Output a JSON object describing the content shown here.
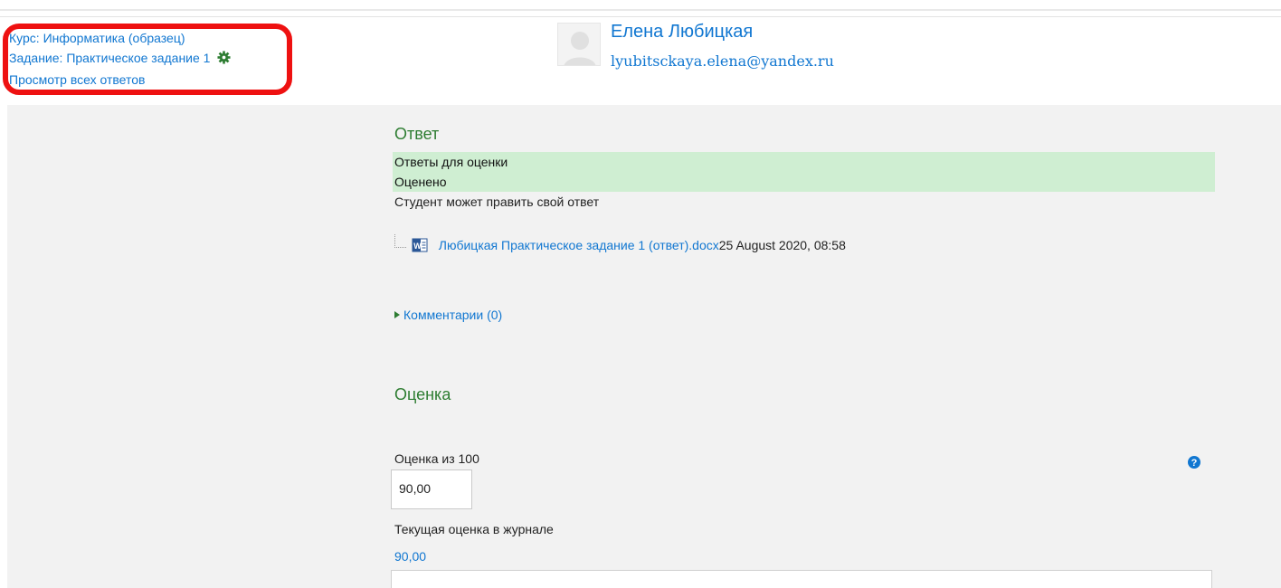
{
  "breadcrumbs": {
    "course": "Курс: Информатика (образец)",
    "assignment": "Задание: Практическое задание 1",
    "view_all": "Просмотр всех ответов"
  },
  "user": {
    "name": "Елена Любицкая",
    "email": "lyubitsckaya.elena@yandex.ru"
  },
  "submission": {
    "heading": "Ответ",
    "status_submission": "Ответы для оценки",
    "status_grading": "Оценено",
    "edit_status": "Студент может править свой ответ",
    "file": {
      "name": "Любицкая Практическое задание 1 (ответ).docx",
      "date": "25 August 2020, 08:58",
      "icon": "word-doc-icon"
    },
    "comments_label": "Комментарии (0)"
  },
  "grade": {
    "heading": "Оценка",
    "label": "Оценка из 100",
    "value": "90,00",
    "current_label": "Текущая оценка в журнале",
    "current_value": "90,00"
  },
  "colors": {
    "link": "#1177d1",
    "heading_green": "#2e7d32",
    "status_bg": "#cfeed2",
    "highlight_red": "#ee1111",
    "content_bg": "#f2f2f2"
  }
}
